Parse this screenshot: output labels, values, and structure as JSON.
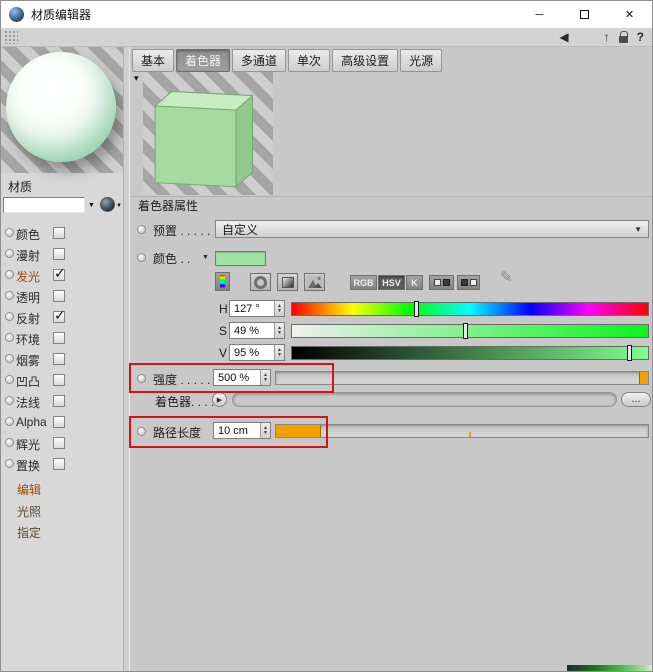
{
  "window": {
    "title": "材质编辑器"
  },
  "icons": {
    "minimize": "─",
    "close": "✕",
    "back": "◀",
    "up": "↑",
    "help": "?",
    "dropdown": "▼",
    "small_down": "▼",
    "spin_up": "▲",
    "spin_down": "▼",
    "collapse": "▾",
    "play": "▶",
    "pencil": "✎"
  },
  "left_panel": {
    "material_label": "材质",
    "name_value": "",
    "channels": [
      {
        "label": "颜色",
        "check": ""
      },
      {
        "label": "漫射",
        "check": ""
      },
      {
        "label": "发光",
        "check": "✓"
      },
      {
        "label": "透明",
        "check": ""
      },
      {
        "label": "反射",
        "check": "✓"
      },
      {
        "label": "环境",
        "check": ""
      },
      {
        "label": "烟雾",
        "check": ""
      },
      {
        "label": "凹凸",
        "check": ""
      },
      {
        "label": "法线",
        "check": ""
      },
      {
        "label": "Alpha",
        "check": ""
      },
      {
        "label": "辉光",
        "check": ""
      },
      {
        "label": "置换",
        "check": ""
      }
    ],
    "modes": [
      {
        "label": "编辑"
      },
      {
        "label": "光照"
      },
      {
        "label": "指定"
      }
    ]
  },
  "tabs": [
    {
      "label": "基本"
    },
    {
      "label": "着色器"
    },
    {
      "label": "多通道"
    },
    {
      "label": "单次"
    },
    {
      "label": "高级设置"
    },
    {
      "label": "光源"
    }
  ],
  "shader": {
    "section_header": "着色器属性",
    "preset_label": "预置 . . . . .",
    "preset_value": "自定义",
    "color_label": "颜色 . .",
    "mode_buttons": {
      "rgb": "RGB",
      "hsv": "HSV",
      "k": "K"
    },
    "h_label": "H",
    "h_value": "127 °",
    "h_percent": 35,
    "s_label": "S",
    "s_value": "49 %",
    "s_percent": 49,
    "v_label": "V",
    "v_value": "95 %",
    "v_percent": 95,
    "strength_label": "强度 . . . . .",
    "strength_value": "500 %",
    "shader_label": "着色器. . . . .",
    "more_button": "...",
    "pathlength_label": "路径长度",
    "pathlength_value": "10 cm",
    "swatch_color": "#9fe3a4",
    "accent_orange": "#f29f00"
  },
  "annotations": {
    "color": "#d41414"
  }
}
